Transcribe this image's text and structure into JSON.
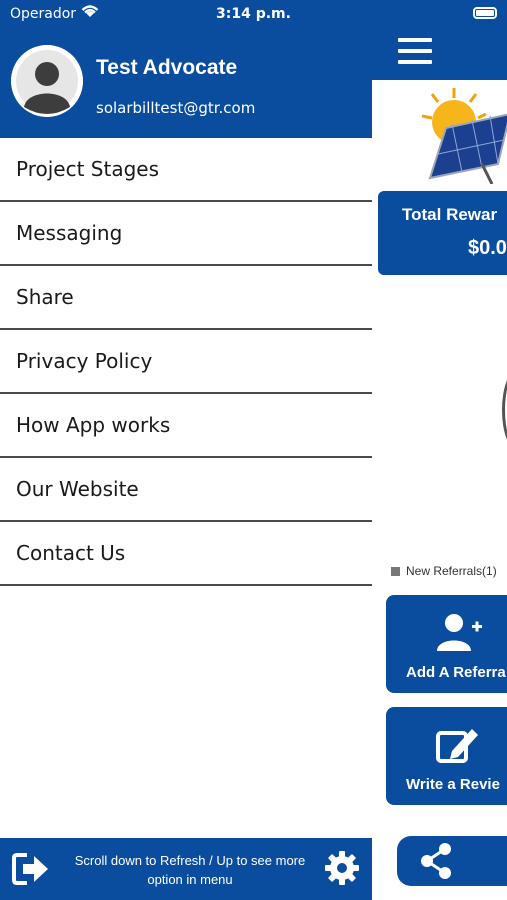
{
  "status_bar": {
    "carrier": "Operador",
    "time": "3:14 p.m."
  },
  "drawer": {
    "user": {
      "name": "Test Advocate",
      "email": "solarbilltest@gtr.com"
    },
    "menu_items": [
      {
        "label": "Project Stages",
        "icon": "none"
      },
      {
        "label": "Messaging",
        "icon": "none"
      },
      {
        "label": "Share",
        "icon": "none"
      },
      {
        "label": "Privacy Policy",
        "icon": "none"
      },
      {
        "label": "How App works",
        "icon": "none"
      },
      {
        "label": "Our Website",
        "icon": "none"
      },
      {
        "label": "Contact Us",
        "icon": "none"
      }
    ],
    "footer": {
      "hint_line1": "Scroll down to Refresh / Up to see more",
      "hint_line2": "option in menu"
    }
  },
  "background_app": {
    "rewards": {
      "title": "Total Rewar",
      "value": "$0.0"
    },
    "legend_label": "New Referrals(1)",
    "actions": [
      {
        "label": "Add A Referra",
        "icon": "add-user-icon"
      },
      {
        "label": "Write a Revie",
        "icon": "edit-icon"
      }
    ]
  },
  "colors": {
    "brand_blue": "#0a4d9e",
    "divider": "#4a4a4a",
    "text": "#1a1a1a"
  }
}
